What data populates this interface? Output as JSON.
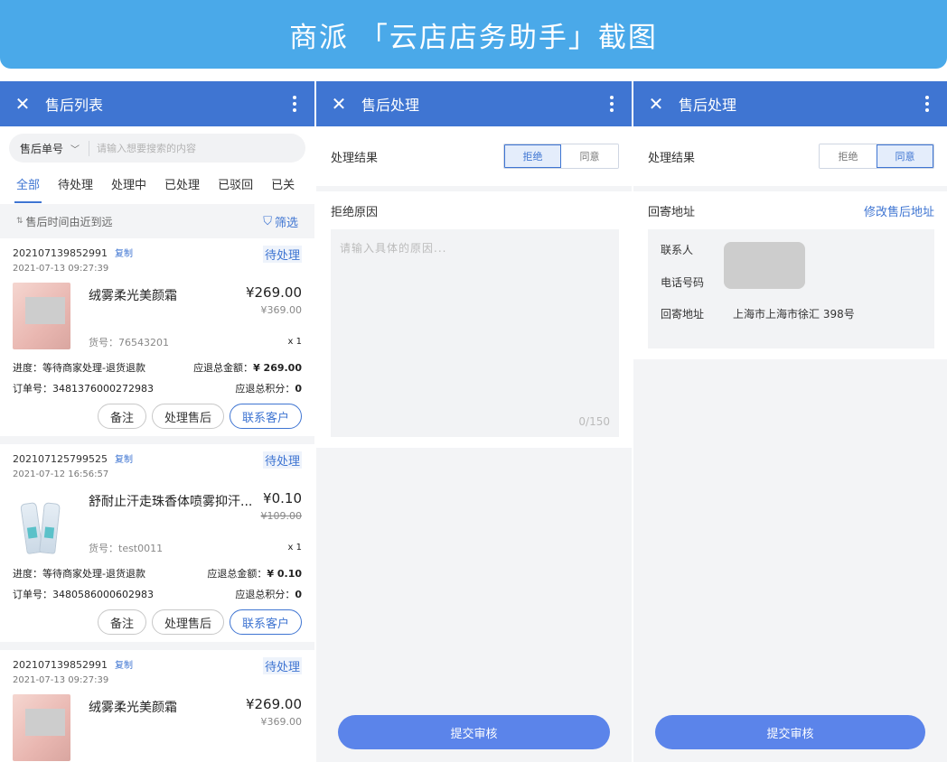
{
  "banner": {
    "title": "商派 「云店店务助手」截图"
  },
  "panel1": {
    "title": "售后列表",
    "search": {
      "select": "售后单号",
      "placeholder": "请输入想要搜索的内容"
    },
    "tabs": [
      "全部",
      "待处理",
      "处理中",
      "已处理",
      "已驳回",
      "已关"
    ],
    "sort_label": "售后时间由近到远",
    "filter_label": "筛选",
    "orders": [
      {
        "id": "202107139852991",
        "copy": "复制",
        "status": "待处理",
        "date": "2021-07-13 09:27:39",
        "product": "绒雾柔光美颜霜",
        "price": "¥269.00",
        "orig_price": "¥369.00",
        "sku": "货号：76543201",
        "qty": "x 1",
        "progress_label": "进度：等待商家处理-退货退款",
        "refund_label": "应退总金额：",
        "refund_value": "¥ 269.00",
        "order_no": "订单号：3481376000272983",
        "points_label": "应退总积分：",
        "points_value": "0",
        "buttons": [
          "备注",
          "处理售后",
          "联系客户"
        ]
      },
      {
        "id": "202107125799525",
        "copy": "复制",
        "status": "待处理",
        "date": "2021-07-12 16:56:57",
        "product": "舒耐止汗走珠香体喷雾抑汗...",
        "price": "¥0.10",
        "orig_price": "¥109.00",
        "sku": "货号：test0011",
        "qty": "x 1",
        "progress_label": "进度：等待商家处理-退货退款",
        "refund_label": "应退总金额：",
        "refund_value": "¥ 0.10",
        "order_no": "订单号：3480586000602983",
        "points_label": "应退总积分：",
        "points_value": "0",
        "buttons": [
          "备注",
          "处理售后",
          "联系客户"
        ]
      },
      {
        "id": "202107139852991",
        "copy": "复制",
        "status": "待处理",
        "date": "2021-07-13 09:27:39",
        "product": "绒雾柔光美颜霜",
        "price": "¥269.00",
        "orig_price": "¥369.00"
      }
    ]
  },
  "panel2": {
    "title": "售后处理",
    "result_label": "处理结果",
    "options": [
      "拒绝",
      "同意"
    ],
    "selected": "拒绝",
    "reason_label": "拒绝原因",
    "reason_placeholder": "请输入具体的原因...",
    "counter": "0/150",
    "submit": "提交审核"
  },
  "panel3": {
    "title": "售后处理",
    "result_label": "处理结果",
    "options": [
      "拒绝",
      "同意"
    ],
    "selected": "同意",
    "address_label": "回寄地址",
    "edit_link": "修改售后地址",
    "contact_label": "联系人",
    "phone_label": "电话号码",
    "addr_label": "回寄地址",
    "addr_value": "上海市上海市徐汇 398号",
    "submit": "提交审核"
  }
}
